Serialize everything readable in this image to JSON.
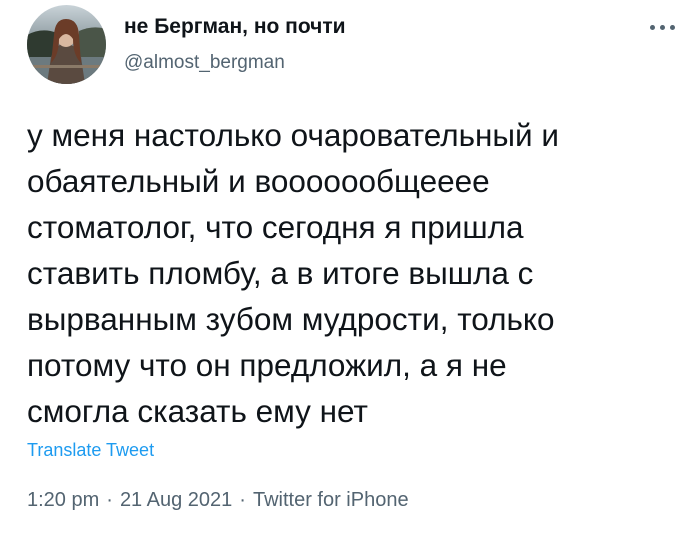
{
  "user": {
    "display_name": "не Бергман, но почти",
    "handle": "@almost_bergman",
    "avatar": "profile-photo"
  },
  "more_icon": "more-horizontal-icon",
  "tweet": {
    "lines": [
      "у меня настолько очаровательный и",
      "обаятельный и вооооообщееее",
      "стоматолог, что сегодня я пришла",
      "ставить пломбу, а в итоге вышла с",
      "вырванным зубом мудрости, только",
      "потому что он предложил, а я не",
      "смогла сказать ему нет"
    ]
  },
  "translate_label": "Translate Tweet",
  "meta": {
    "time": "1:20 pm",
    "separator": "·",
    "date": "21 Aug 2021",
    "source": "Twitter for iPhone"
  },
  "colors": {
    "text": "#0f1419",
    "secondary": "#536471",
    "link": "#1d9bf0"
  }
}
